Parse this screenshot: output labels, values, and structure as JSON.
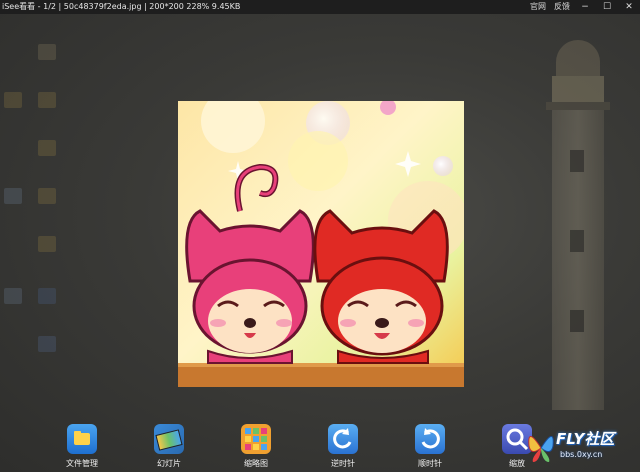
{
  "window": {
    "title": "iSee看看 - 1/2 | 50c48379f2eda.jpg | 200*200  228%  9.45KB",
    "links": [
      "官网",
      "反馈"
    ],
    "controls": {
      "minimize": "−",
      "maximize": "☐",
      "close": "✕"
    }
  },
  "toolbar": {
    "items": [
      {
        "label": "文件管理",
        "icon": "folder-icon"
      },
      {
        "label": "幻灯片",
        "icon": "slideshow-icon"
      },
      {
        "label": "缩略图",
        "icon": "thumbnail-icon"
      },
      {
        "label": "逆时针",
        "icon": "rotate-ccw-icon"
      },
      {
        "label": "顺时针",
        "icon": "rotate-cw-icon"
      },
      {
        "label": "缩放",
        "icon": "zoom-icon"
      }
    ]
  },
  "watermark": {
    "brand": "FLY社区",
    "url": "bbs.0xy.cn"
  },
  "colors": {
    "titlebar": "#1e1e1e",
    "fox_pink": "#e8407a",
    "fox_red": "#e02a24",
    "floor": "#c8782f"
  }
}
